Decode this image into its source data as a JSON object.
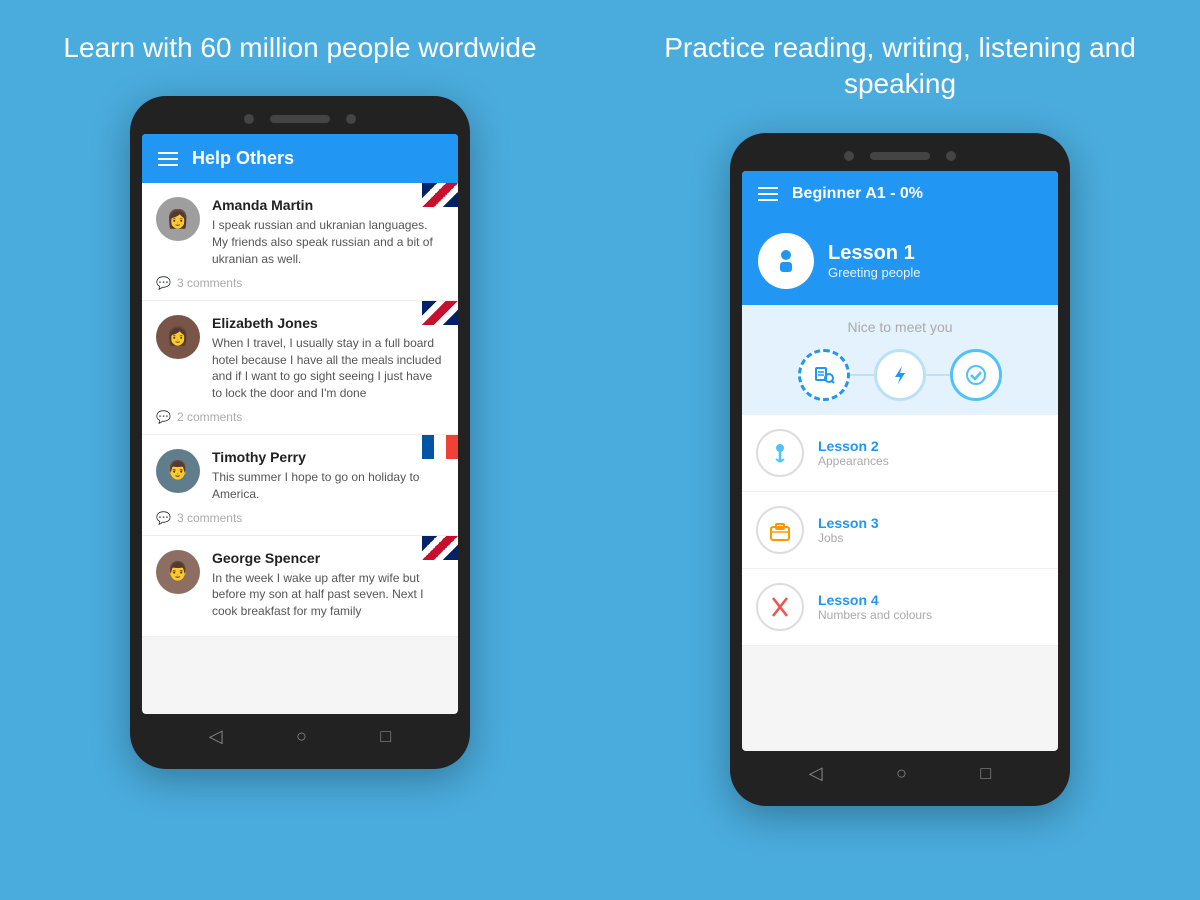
{
  "left_panel": {
    "title": "Learn with 60 million people wordwide",
    "app_title": "Help Others",
    "posts": [
      {
        "name": "Amanda Martin",
        "text": "I speak russian and ukranian languages. My friends also speak russian and a bit of ukranian as well.",
        "comments": "3 comments",
        "flag": "uk",
        "avatar_emoji": "👩"
      },
      {
        "name": "Elizabeth Jones",
        "text": "When I travel, I usually stay in a full board hotel because I have all the meals included and if I want to go sight seeing I just have to lock the door and I'm done",
        "comments": "2 comments",
        "flag": "uk",
        "avatar_emoji": "👩"
      },
      {
        "name": "Timothy Perry",
        "text": "This summer I hope to go on holiday to America.",
        "comments": "3 comments",
        "flag": "fr",
        "avatar_emoji": "👨"
      },
      {
        "name": "George Spencer",
        "text": "In the week I wake up after my wife but before my son at half past seven. Next I cook breakfast for my family",
        "comments": "",
        "flag": "uk",
        "avatar_emoji": "👨"
      }
    ]
  },
  "right_panel": {
    "title": "Practice reading, writing, listening and speaking",
    "header_title": "Beginner A1 - 0%",
    "lesson1": {
      "title": "Lesson 1",
      "subtitle": "Greeting people"
    },
    "meet_section": {
      "title": "Nice to meet you"
    },
    "lessons": [
      {
        "title": "Lesson 2",
        "subtitle": "Appearances",
        "icon_color": "#4fc3f7",
        "icon": "🌿"
      },
      {
        "title": "Lesson 3",
        "subtitle": "Jobs",
        "icon_color": "#ff9800",
        "icon": "💼"
      },
      {
        "title": "Lesson 4",
        "subtitle": "Numbers and colours",
        "icon_color": "#ef5350",
        "icon": "✂"
      }
    ]
  },
  "nav": {
    "back": "◁",
    "home": "○",
    "square": "□"
  }
}
